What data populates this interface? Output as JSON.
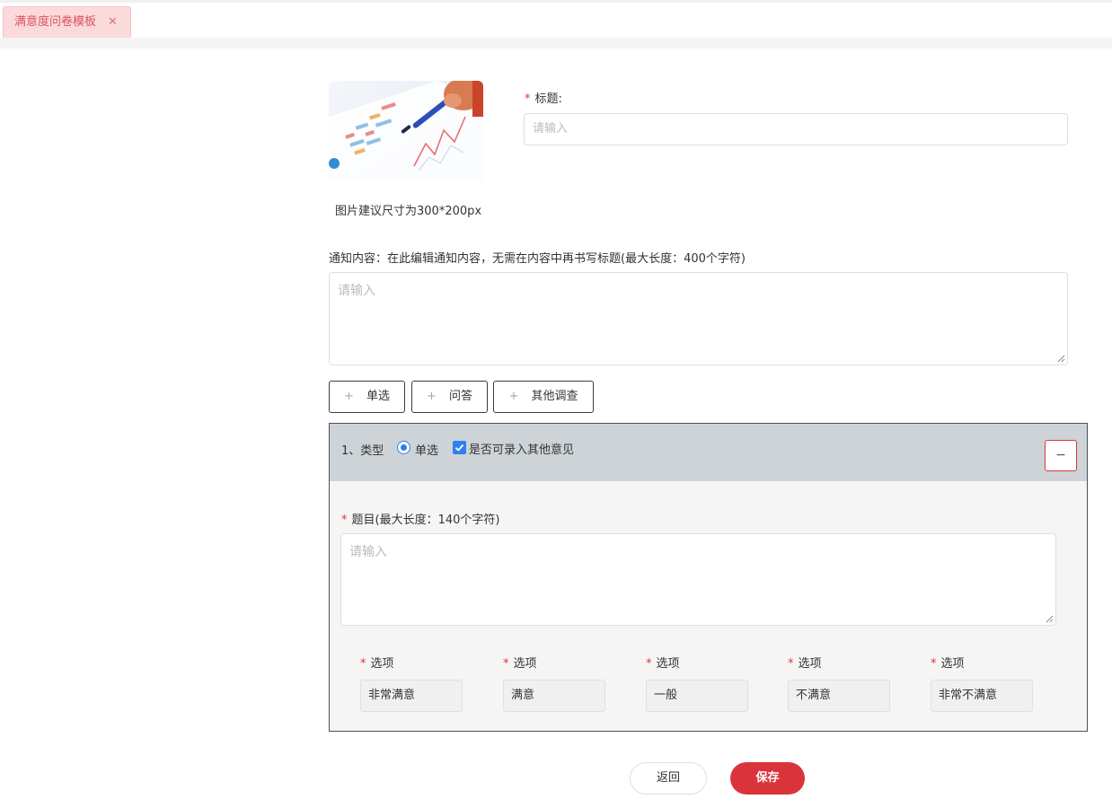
{
  "tab": {
    "label": "满意度问卷模板",
    "close_glyph": "✕"
  },
  "cover": {
    "hint": "图片建议尺寸为300*200px"
  },
  "title_field": {
    "required_mark": "*",
    "label": "标题:",
    "placeholder": "请输入"
  },
  "notice": {
    "label": "通知内容：在此编辑通知内容，无需在内容中再书写标题(最大长度：400个字符)",
    "placeholder": "请输入"
  },
  "add_buttons": [
    {
      "icon": "plus-icon",
      "plus": "+",
      "label": "单选"
    },
    {
      "icon": "plus-icon",
      "plus": "+",
      "label": "问答"
    },
    {
      "icon": "plus-icon",
      "plus": "+",
      "label": "其他调查"
    }
  ],
  "question": {
    "number_label": "1、类型",
    "type_radio_label": "单选",
    "type_radio_checked": true,
    "allow_other_label": "是否可录入其他意见",
    "allow_other_checked": true,
    "remove_glyph": "−",
    "title_required_mark": "*",
    "title_label": "题目(最大长度：140个字符)",
    "title_placeholder": "请输入",
    "options": [
      {
        "label": "选项",
        "value": "非常满意"
      },
      {
        "label": "选项",
        "value": "满意"
      },
      {
        "label": "选项",
        "value": "一般"
      },
      {
        "label": "选项",
        "value": "不满意"
      },
      {
        "label": "选项",
        "value": "非常不满意"
      }
    ]
  },
  "footer": {
    "back_label": "返回",
    "save_label": "保存"
  },
  "colors": {
    "accent_red": "#d9343b",
    "tab_bg": "#fbdadb",
    "checkbox_blue": "#2f80ed",
    "question_header": "#cdd3d7"
  }
}
